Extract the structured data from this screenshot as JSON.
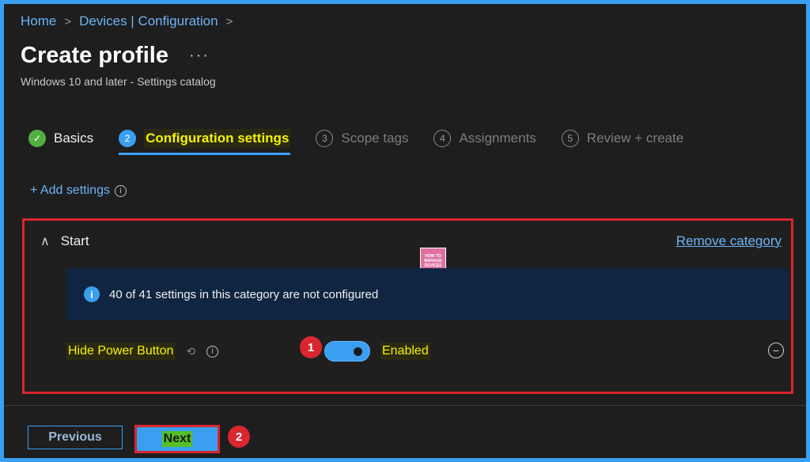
{
  "breadcrumb": {
    "items": [
      "Home",
      "Devices | Configuration"
    ],
    "separator": ">"
  },
  "header": {
    "title": "Create profile",
    "more": "···",
    "subtitle": "Windows 10 and later - Settings catalog"
  },
  "tabs": [
    {
      "step": "✓",
      "label": "Basics",
      "state": "done"
    },
    {
      "step": "2",
      "label": "Configuration settings",
      "state": "active"
    },
    {
      "step": "3",
      "label": "Scope tags",
      "state": "inactive"
    },
    {
      "step": "4",
      "label": "Assignments",
      "state": "inactive"
    },
    {
      "step": "5",
      "label": "Review + create",
      "state": "inactive"
    }
  ],
  "add_settings": {
    "label": "+ Add settings",
    "info": "i"
  },
  "category": {
    "chevron": "∧",
    "name": "Start",
    "remove_label": "Remove category",
    "logo_lines": [
      "HOW TO",
      "MANAGE",
      "DEVICES"
    ],
    "banner_icon": "i",
    "banner_text": "40 of 41 settings in this category are not configured",
    "setting": {
      "name": "Hide Power Button",
      "sync_icon": "⟲",
      "info": "i",
      "marker": "1",
      "toggle_on": true,
      "toggle_label": "Enabled",
      "remove_icon": "−"
    }
  },
  "footer": {
    "previous_label": "Previous",
    "next_label": "Next",
    "marker": "2"
  },
  "colors": {
    "accent": "#3a9ff0",
    "highlight": "#f7f200",
    "annotation_red": "#d9262f",
    "success": "#52b043"
  }
}
